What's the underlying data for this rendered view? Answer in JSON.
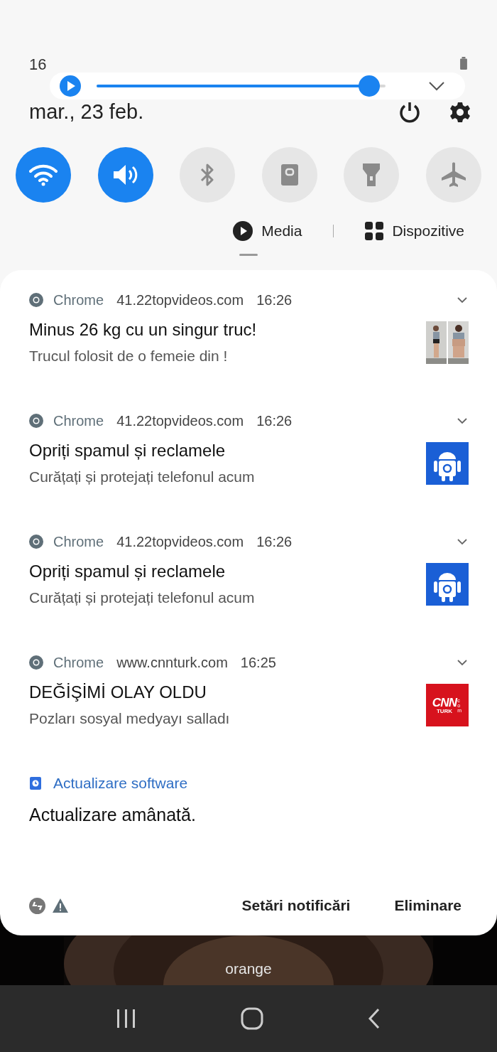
{
  "status_bar": {
    "time": "16"
  },
  "brightness": {
    "level": 0.98
  },
  "header": {
    "date": "mar., 23 feb."
  },
  "toggles": [
    {
      "kind": "wifi",
      "on": true
    },
    {
      "kind": "sound",
      "on": true
    },
    {
      "kind": "bluetooth",
      "on": false
    },
    {
      "kind": "lock",
      "on": false
    },
    {
      "kind": "flashlight",
      "on": false
    },
    {
      "kind": "airplane",
      "on": false
    }
  ],
  "media_bar": {
    "media": "Media",
    "devices": "Dispozitive"
  },
  "notifications": [
    {
      "kind": "web",
      "app": "Chrome",
      "source": "41.22topvideos.com",
      "time": "16:26",
      "title": "Minus 26 kg cu un singur truc!",
      "body": "Trucul folosit de o femeie din !"
    },
    {
      "kind": "web",
      "app": "Chrome",
      "source": "41.22topvideos.com",
      "time": "16:26",
      "title": "Opriți spamul și reclamele",
      "body": "Curățați și protejați telefonul acum",
      "thumb": {
        "kind": "android"
      }
    },
    {
      "kind": "web",
      "app": "Chrome",
      "source": "41.22topvideos.com",
      "time": "16:26",
      "title": "Opriți spamul și reclamele",
      "body": "Curățați și protejați telefonul acum",
      "thumb": {
        "kind": "android"
      }
    },
    {
      "kind": "web",
      "app": "Chrome",
      "source": "www.cnnturk.com",
      "time": "16:25",
      "title": "DEĞİŞİMİ OLAY OLDU",
      "body": "Pozları sosyal medyayı salladı",
      "thumb": {
        "kind": "logo",
        "text": "CNN",
        "subtext": "TURK",
        "side": "com"
      }
    },
    {
      "kind": "system",
      "app": "Actualizare software",
      "title": "Actualizare amânată."
    }
  ],
  "footer": {
    "settings": "Setări notificări",
    "clear": "Eliminare"
  },
  "lock_screen": {
    "carrier": "orange"
  }
}
